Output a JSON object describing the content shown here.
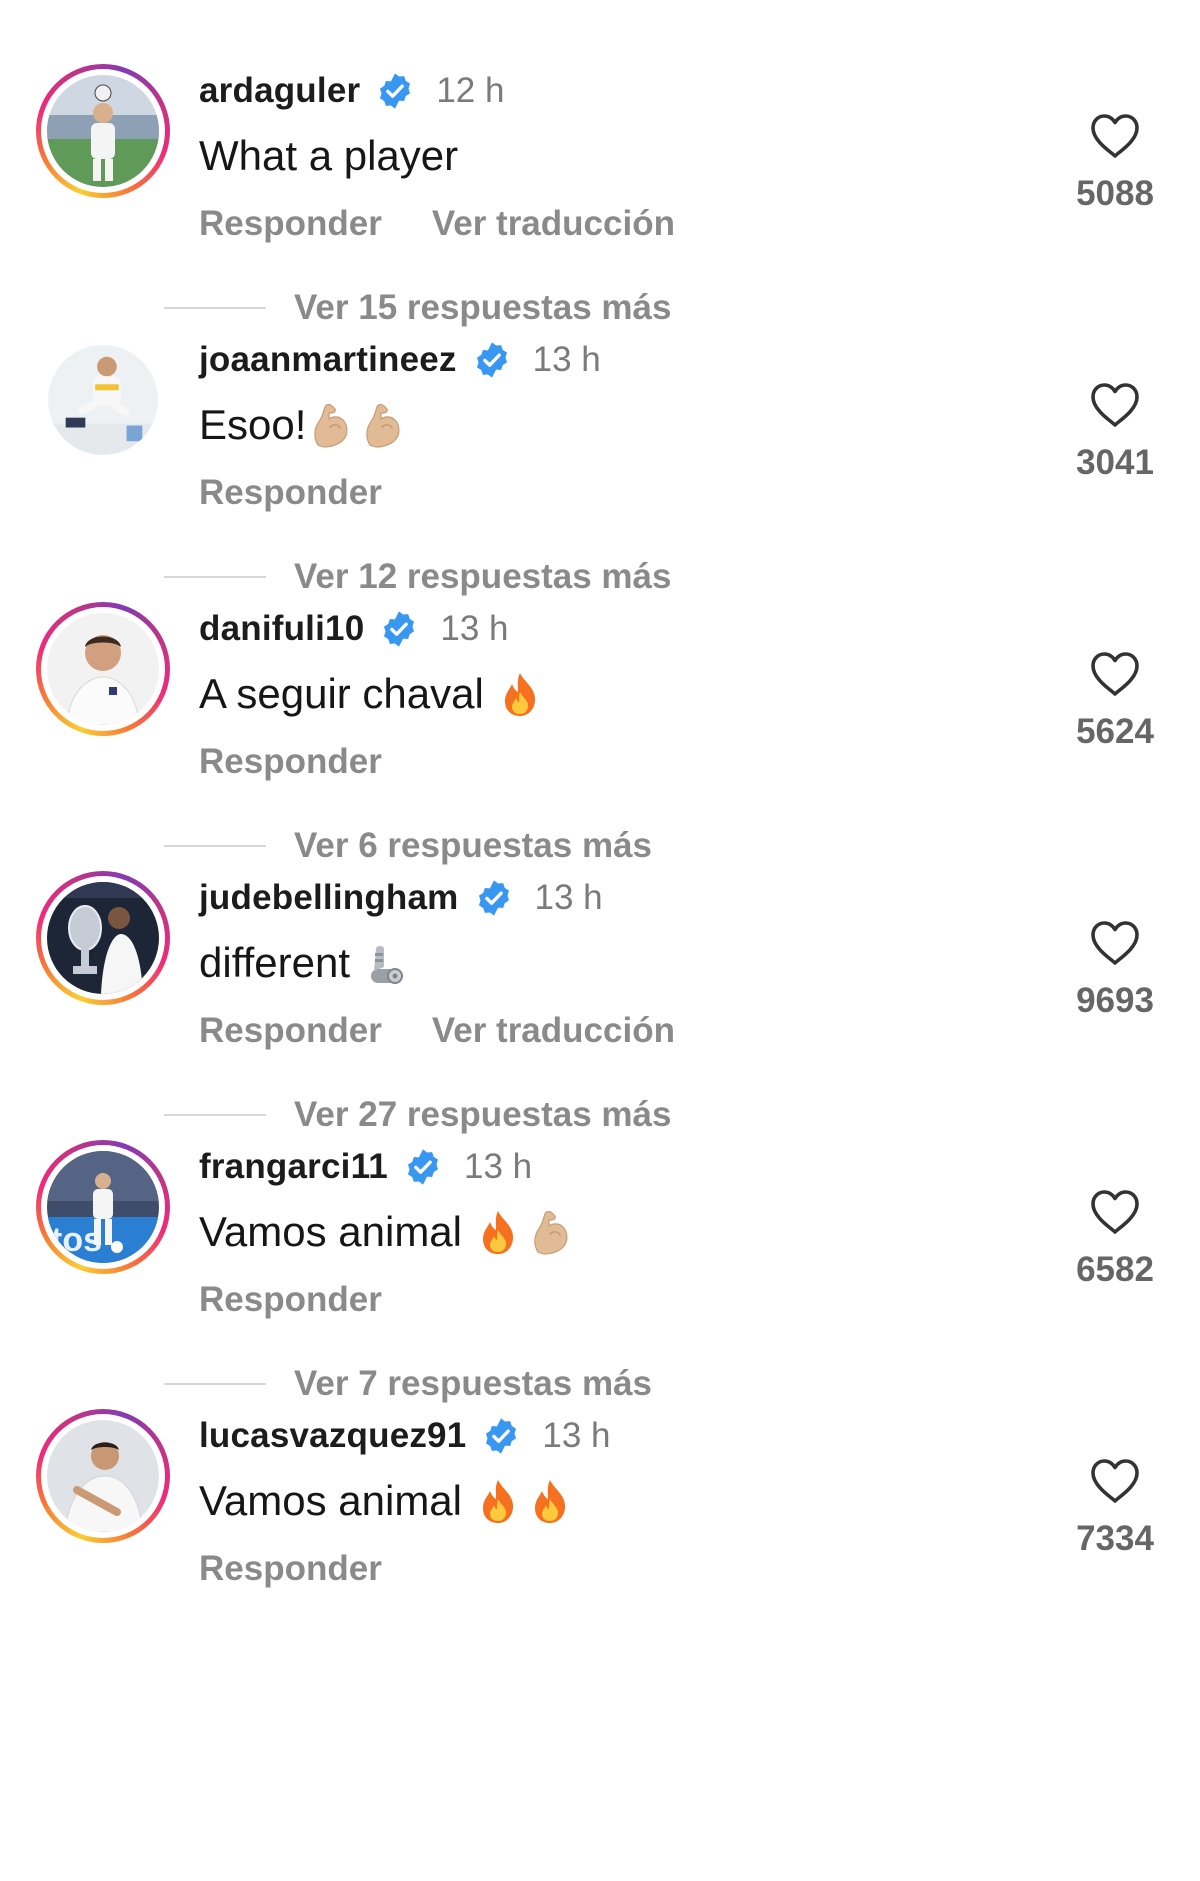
{
  "comments": [
    {
      "username": "ardaguler",
      "time": "12 h",
      "text": "What a player",
      "emojis": [],
      "actions": [
        "Responder",
        "Ver traducción"
      ],
      "replies_label": "Ver 15 respuestas más",
      "likes": "5088",
      "story_ring": true,
      "avatar_icon": "player-photo-avatar"
    },
    {
      "username": "joaanmartineez",
      "time": "13 h",
      "text": "Esoo!",
      "emojis": [
        "flexed-biceps-icon",
        "flexed-biceps-icon"
      ],
      "actions": [
        "Responder"
      ],
      "replies_label": "Ver 12 respuestas más",
      "likes": "3041",
      "story_ring": false,
      "avatar_icon": "player-photo-avatar"
    },
    {
      "username": "danifuli10",
      "time": "13 h",
      "text": "A seguir chaval",
      "emojis": [
        "fire-icon"
      ],
      "actions": [
        "Responder"
      ],
      "replies_label": "Ver 6 respuestas más",
      "likes": "5624",
      "story_ring": true,
      "avatar_icon": "player-photo-avatar"
    },
    {
      "username": "judebellingham",
      "time": "13 h",
      "text": "different",
      "emojis": [
        "mechanical-arm-icon"
      ],
      "actions": [
        "Responder",
        "Ver traducción"
      ],
      "replies_label": "Ver 27 respuestas más",
      "likes": "9693",
      "story_ring": true,
      "avatar_icon": "player-photo-avatar"
    },
    {
      "username": "frangarci11",
      "time": "13 h",
      "text": "Vamos animal",
      "emojis": [
        "fire-icon",
        "flexed-biceps-icon"
      ],
      "actions": [
        "Responder"
      ],
      "replies_label": "Ver 7 respuestas más",
      "likes": "6582",
      "story_ring": true,
      "avatar_icon": "player-photo-avatar"
    },
    {
      "username": "lucasvazquez91",
      "time": "13 h",
      "text": "Vamos animal",
      "emojis": [
        "fire-icon",
        "fire-icon"
      ],
      "actions": [
        "Responder"
      ],
      "replies_label": "",
      "likes": "7334",
      "story_ring": true,
      "avatar_icon": "player-photo-avatar"
    }
  ],
  "colors": {
    "verified_badge": "#3897f0",
    "secondary_text": "#8a8a8a",
    "primary_text": "#161616",
    "story_ring_start": "#f9ce34",
    "story_ring_end": "#c13584"
  },
  "icons": {
    "verified": "verified-badge-icon",
    "like": "heart-outline-icon"
  }
}
